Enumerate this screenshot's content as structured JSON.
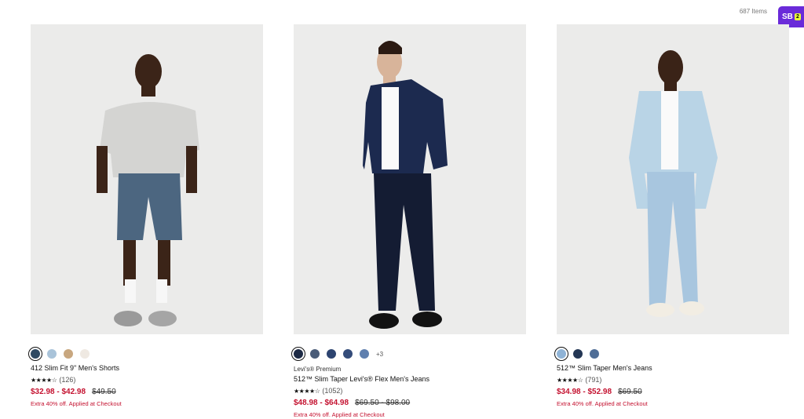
{
  "header": {
    "items_count": "687 Items",
    "sb_label": "SB",
    "sb_count": "2"
  },
  "products": [
    {
      "brand": "",
      "name": "412 Slim Fit 9\" Men's Shorts",
      "stars": "★★★★☆",
      "reviews": "(126)",
      "sale_price": "$32.98 - $42.98",
      "original_price": "$49.50",
      "promo": "Extra 40% off. Applied at Checkout",
      "swatches": [
        "#2f4a63",
        "#a9c3d9",
        "#c8a77f",
        "#efe9e2"
      ],
      "more_swatches": ""
    },
    {
      "brand": "Levi's® Premium",
      "name": "512™ Slim Taper Levi's® Flex Men's Jeans",
      "stars": "★★★★☆",
      "reviews": "(1052)",
      "sale_price": "$48.98 - $64.98",
      "original_price": "$69.50 - $98.00",
      "promo": "Extra 40% off. Applied at Checkout",
      "swatches": [
        "#1d2a45",
        "#4a5c78",
        "#2d4470",
        "#344c7a",
        "#5f7fae"
      ],
      "more_swatches": "+3"
    },
    {
      "brand": "",
      "name": "512™ Slim Taper Men's Jeans",
      "stars": "★★★★☆",
      "reviews": "(791)",
      "sale_price": "$34.98 - $52.98",
      "original_price": "$69.50",
      "promo": "Extra 40% off. Applied at Checkout",
      "swatches": [
        "#8fb3d6",
        "#233654",
        "#4f6d96"
      ],
      "more_swatches": ""
    }
  ]
}
